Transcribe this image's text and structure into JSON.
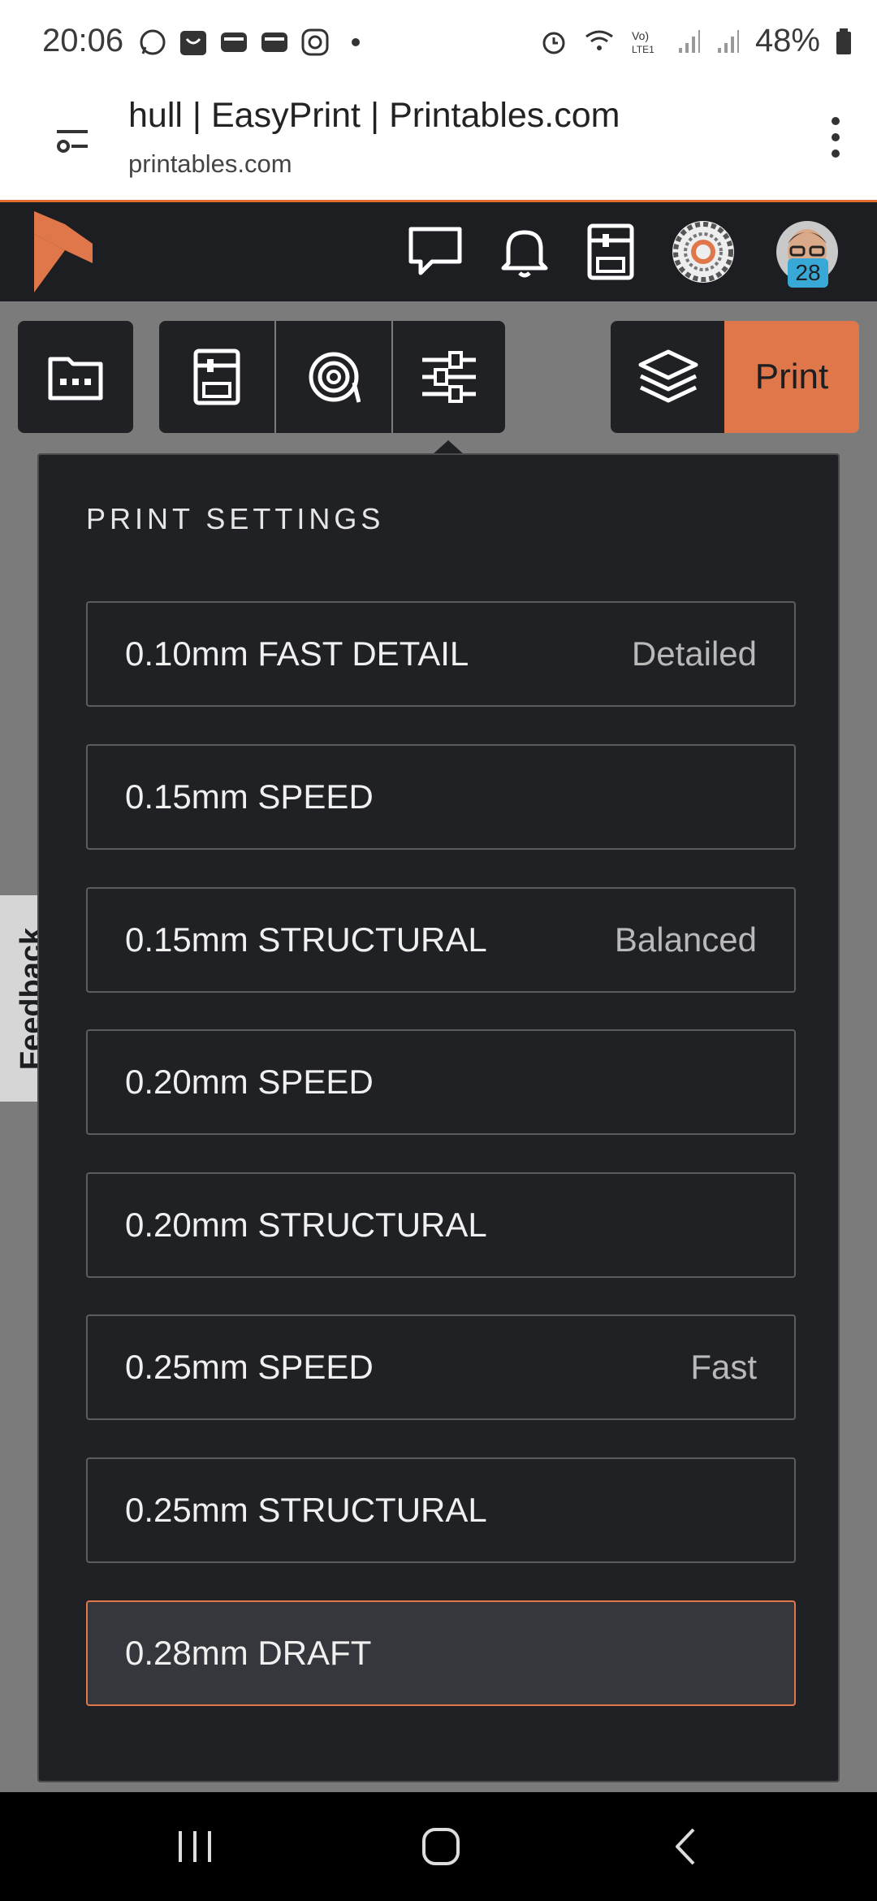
{
  "status_bar": {
    "time": "20:06",
    "battery": "48%",
    "icons": [
      "whatsapp-icon",
      "shop-icon",
      "wallet-icon",
      "wallet-icon",
      "instagram-icon",
      "dot-icon",
      "alarm-icon",
      "wifi-icon",
      "volte-icon",
      "signal-icon",
      "signal-icon",
      "battery-icon"
    ]
  },
  "browser": {
    "title": "hull | EasyPrint | Printables.com",
    "domain": "printables.com"
  },
  "header": {
    "notification_count": "28",
    "accent_color": "#e0774a"
  },
  "toolbar": {
    "print_label": "Print"
  },
  "feedback_label": "Feedback",
  "popup": {
    "title": "PRINT SETTINGS",
    "options": [
      {
        "label": "0.10mm FAST DETAIL",
        "tag": "Detailed"
      },
      {
        "label": "0.15mm SPEED",
        "tag": ""
      },
      {
        "label": "0.15mm STRUCTURAL",
        "tag": "Balanced"
      },
      {
        "label": "0.20mm SPEED",
        "tag": ""
      },
      {
        "label": "0.20mm STRUCTURAL",
        "tag": ""
      },
      {
        "label": "0.25mm SPEED",
        "tag": "Fast"
      },
      {
        "label": "0.25mm STRUCTURAL",
        "tag": ""
      },
      {
        "label": "0.28mm DRAFT",
        "tag": "",
        "selected": true
      }
    ]
  }
}
